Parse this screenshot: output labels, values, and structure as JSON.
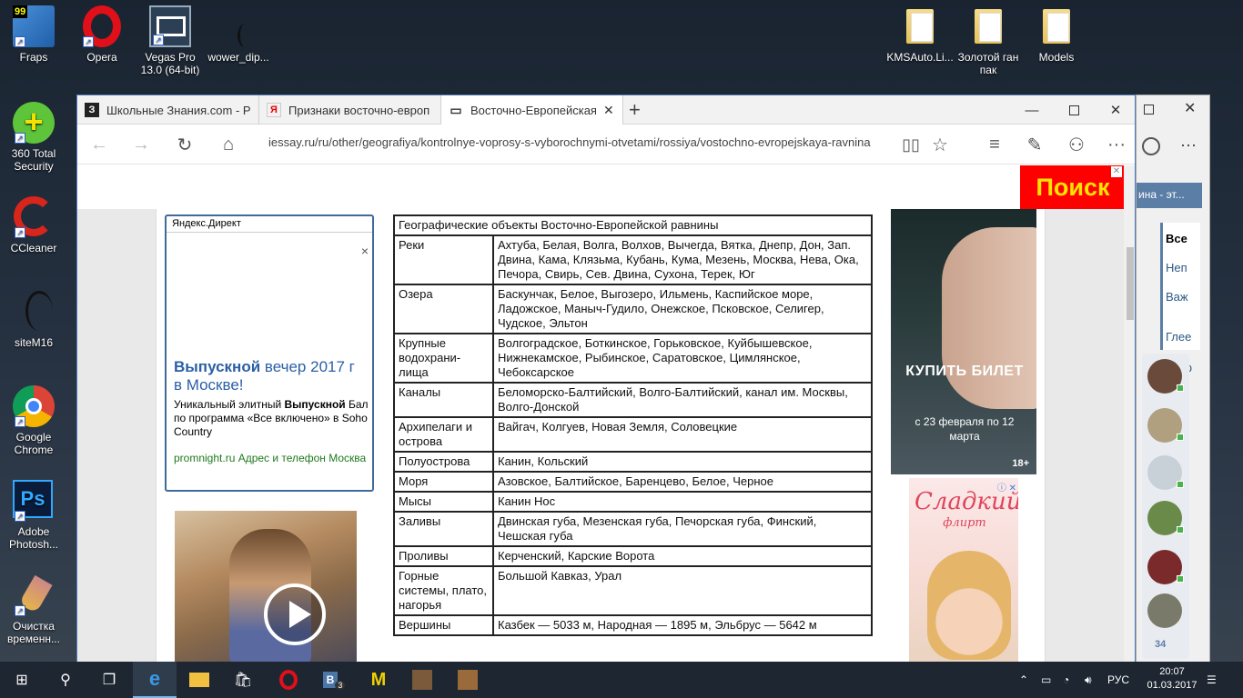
{
  "desktop": {
    "icons_left": [
      {
        "label": "Fraps",
        "icon": "fraps-icon"
      },
      {
        "label": "Opera",
        "icon": "opera-icon"
      },
      {
        "label": "Vegas Pro 13.0 (64-bit)",
        "icon": "vegas-icon"
      },
      {
        "label": "wower_dip...",
        "icon": "file-icon"
      },
      {
        "label": "360 Total Security",
        "icon": "360-security-icon"
      },
      {
        "label": "CCleaner",
        "icon": "ccleaner-icon"
      },
      {
        "label": "siteM16",
        "icon": "file-icon"
      },
      {
        "label": "Google Chrome",
        "icon": "chrome-icon"
      },
      {
        "label": "Adobe Photosh...",
        "icon": "photoshop-icon"
      },
      {
        "label": "Очистка временн...",
        "icon": "broom-icon"
      }
    ],
    "icons_right": [
      {
        "label": "KMSAuto.Li...",
        "icon": "folder-icon"
      },
      {
        "label": "Золотой ган пак",
        "icon": "folder-icon"
      },
      {
        "label": "Models",
        "icon": "folder-icon"
      }
    ],
    "fraps_counter": "99"
  },
  "browser": {
    "tabs": [
      {
        "label": "Школьные Знания.com - Р",
        "favicon": "З"
      },
      {
        "label": "Признаки восточно-европ",
        "favicon": "Я"
      },
      {
        "label": "Восточно-Европейская",
        "favicon": "▭"
      }
    ],
    "url": "iessay.ru/ru/other/geografiya/kontrolnye-voprosy-s-vyborochnymi-otvetami/rossiya/vostochno-evropejskaya-ravnina",
    "search_ad": "Поиск",
    "search_ad_close": "✕"
  },
  "yandex_ad": {
    "header": "Яндекс.Директ",
    "close": "×",
    "title_bold": "Выпускной",
    "title_rest": " вечер 2017 г в Москве!",
    "text_start": "Уникальный элитный ",
    "text_bold": "Выпускной",
    "text_end": " Бал по программа «Все включено» в Soho Country",
    "link": "promnight.ru    Адрес и телефон Москва"
  },
  "table": {
    "header": "Географические объекты Восточно-Европейской равнины",
    "rows": [
      {
        "k": "Реки",
        "v": "Ахтуба, Белая, Волга, Волхов, Вычегда, Вятка, Днепр, Дон, Зап. Двина, Кама, Клязьма, Кубань, Кума, Мезень, Москва, Нева, Ока, Печора, Свирь, Сев. Двина, Сухона, Терек, Юг"
      },
      {
        "k": "Озера",
        "v": "Баскунчак, Белое, Выгозеро, Ильмень, Каспийское море, Ладожское, Маныч-Гудило, Онежское, Псковское, Селигер, Чудское, Эльтон"
      },
      {
        "k": "Крупные водохрани-лища",
        "v": "Волгоградское, Боткинское, Горьковское, Куйбышевское, Нижнекамское, Рыбинское, Саратовское, Цимлянское, Чебоксарское"
      },
      {
        "k": "Каналы",
        "v": "Беломорско-Балтийский, Волго-Балтийский, канал им. Москвы, Волго-Донской"
      },
      {
        "k": "Архипелаги и острова",
        "v": "Вайгач, Колгуев, Новая Земля, Соловецкие"
      },
      {
        "k": "Полуострова",
        "v": "Канин, Кольский"
      },
      {
        "k": "Моря",
        "v": "Азовское, Балтийское, Баренцево, Белое, Черное"
      },
      {
        "k": "Мысы",
        "v": "Канин Нос"
      },
      {
        "k": "Заливы",
        "v": "Двинская губа, Мезенская губа, Печорская губа, Финский, Чешская губа"
      },
      {
        "k": "Проливы",
        "v": "Керченский, Карские Ворота"
      },
      {
        "k": "Горные системы, плато, нагорья",
        "v": "Большой Кавказ, Урал"
      },
      {
        "k": "Вершины",
        "v": "Казбек — 5033 м, Народная — 1895 м, Эльбрус — 5642 м"
      }
    ]
  },
  "right_ad": {
    "buy": "КУПИТЬ БИЛЕТ",
    "dates": "с 23 февраля по 12 марта",
    "age": "18+"
  },
  "game_ad": {
    "brand": "Сладкий",
    "brand2": "флирт"
  },
  "bg_window": {
    "title_fragment": "ина - эт...",
    "items": [
      "Все",
      "Неп",
      "Важ",
      "Глее",
      "юр"
    ],
    "count": "34"
  },
  "taskbar": {
    "lang": "РУС",
    "time": "20:07",
    "date": "01.03.2017",
    "vk_badge": "3"
  }
}
